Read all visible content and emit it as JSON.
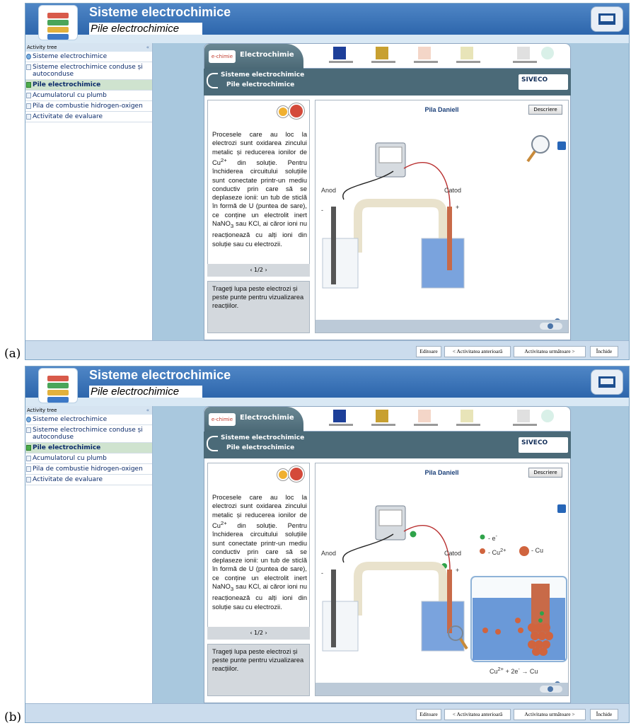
{
  "panels": [
    {
      "label": "(a)"
    },
    {
      "label": "(b)"
    }
  ],
  "app": {
    "title": "Sisteme electrochimice",
    "subtitle": "Pile electrochimice"
  },
  "sidebar": {
    "header": "Activity tree",
    "collapse": "«",
    "items": [
      {
        "label": "Sisteme electrochimice"
      },
      {
        "label": "Sisteme electrochimice conduse și autoconduse"
      },
      {
        "label": "Pile electrochimice"
      },
      {
        "label": "Acumulatorul cu plumb"
      },
      {
        "label": "Pila de combustie hidrogen-oxigen"
      },
      {
        "label": "Activitate de evaluare"
      }
    ]
  },
  "topbar": {
    "brand": "Electrochimie",
    "badge": "e-chimie"
  },
  "breadcrumb": {
    "level1": "Sisteme electrochimice",
    "level2": "Pile electrochimice"
  },
  "siveco": "SIVECO",
  "text": {
    "body_a": "Procesele care au loc la electrozi sunt oxidarea zincului metalic și reducerea ionilor de Cu",
    "sup": "2+",
    "body_b": " din soluție. Pentru închiderea circuitului soluțiile sunt conectate printr-un mediu conductiv prin care să se deplaseze ionii: un tub de sticlă în formă de U (puntea de sare), ce conține un electrolit inert NaNO",
    "sub": "3",
    "body_c": " sau KCl, ai căror ioni nu reacționează cu alți ioni din soluție sau cu electrozii.",
    "pager": "‹ 1/2 ›",
    "hint": "Trageți lupa peste electrozi și peste punte pentru vizualizarea reacțiilor."
  },
  "sim": {
    "title": "Pila Daniell",
    "describe_button": "Descriere",
    "anode": "Anod",
    "cathode": "Catod",
    "minus": "-",
    "plus": "+"
  },
  "legend": {
    "electron": "- e",
    "electron_sup": "-",
    "cu_ion": "- Cu",
    "cu_ion_sup": "2+",
    "cu": "- Cu"
  },
  "reaction": {
    "part1": "Cu",
    "sup1": "2+",
    "part2": " + 2e",
    "sup2": "-",
    "part3": " → Cu"
  },
  "footer": {
    "editors": "Editoare",
    "previous": "< Activitatea anterioară",
    "next": "Activitatea următoare >",
    "close": "Închide"
  },
  "colors": {
    "header": "#2d66ac",
    "bread": "#4b6a78",
    "copper": "#c86a48",
    "electrolyte": "#6a99d8",
    "electron": "#2fa34a"
  }
}
